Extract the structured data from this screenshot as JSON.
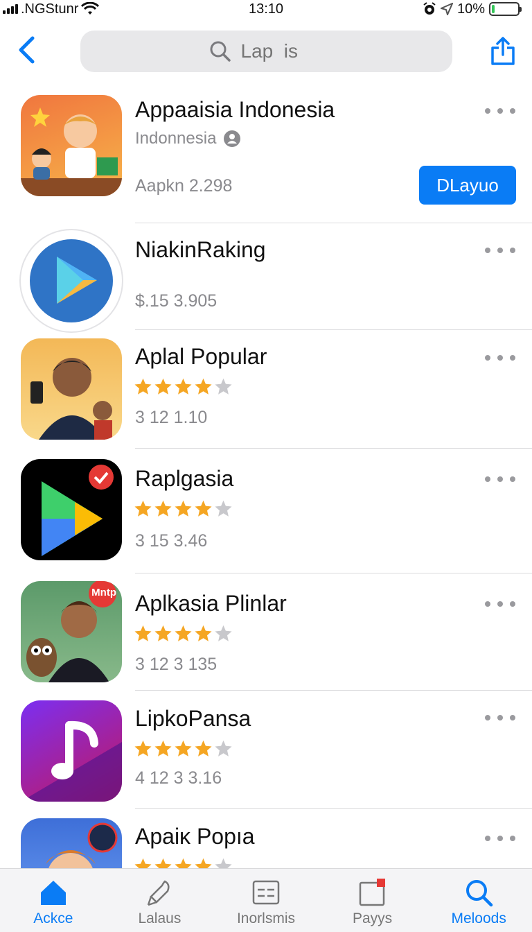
{
  "status_bar": {
    "carrier": ".NGStunr",
    "time": "13:10",
    "battery": "10%",
    "battery_level": 0.1
  },
  "nav": {
    "search_placeholder": "Lap  is"
  },
  "apps": [
    {
      "name": "Appaaisia Indonesia",
      "subtitle": "Indonnesia",
      "meta": "Aapkn 2.298",
      "action": "DLayuo",
      "icon": "cartoon-kids-icon"
    },
    {
      "name": "NiakinRaking",
      "meta": "$.15 3.905",
      "icon": "play-store-round-icon"
    },
    {
      "name": "Aplal Popular",
      "rating": 4,
      "meta": "3 12 1.10",
      "icon": "man-with-phone-icon"
    },
    {
      "name": "Raplɡasia",
      "rating": 4,
      "meta": "3 15 3.46",
      "icon": "play-store-dark-icon"
    },
    {
      "name": "Aplkasia Plinlar",
      "rating": 4,
      "meta": "3 12 3 135",
      "icon": "man-with-owl-icon",
      "badge": "Mntp"
    },
    {
      "name": "LipkoPansa",
      "rating": 4,
      "meta": "4 12 3 3.16",
      "icon": "music-note-icon"
    },
    {
      "name": "Apaiĸ Popıa",
      "rating": 4,
      "meta": "",
      "icon": "cartoon-man-icon"
    }
  ],
  "tabs": [
    {
      "label": "Ackce",
      "icon": "home-icon",
      "active": true
    },
    {
      "label": "Lalaus",
      "icon": "rocket-icon",
      "active": false
    },
    {
      "label": "Inorlsmis",
      "icon": "grid-icon",
      "active": false
    },
    {
      "label": "Payys",
      "icon": "calendar-icon",
      "active": false
    },
    {
      "label": "Meloods",
      "icon": "search-icon",
      "active": true
    }
  ],
  "colors": {
    "accent": "#0a7cf5",
    "star": "#f5a623",
    "star_empty": "#c8c8cc"
  }
}
